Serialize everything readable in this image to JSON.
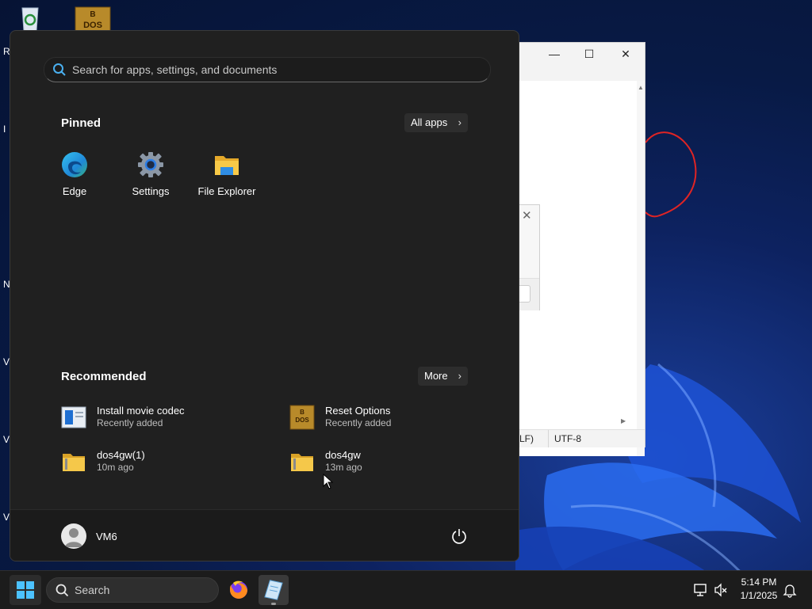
{
  "colors": {
    "accent": "#0078d4",
    "start_bg": "#202020",
    "taskbar_bg": "#1c1c1c"
  },
  "desktop": {
    "icons": [
      "recycle-bin-icon",
      "dosbox-icon"
    ],
    "edge_letters": [
      "R",
      "I",
      "N",
      "V",
      "V",
      "V"
    ]
  },
  "notepad": {
    "controls": [
      "—",
      "☐",
      "✕"
    ],
    "status": {
      "line_ending": "LF)",
      "encoding": "UTF-8"
    }
  },
  "start_menu": {
    "search": {
      "placeholder": "Search for apps, settings, and documents"
    },
    "pinned": {
      "title": "Pinned",
      "all_apps_label": "All apps",
      "apps": [
        {
          "label": "Edge",
          "icon": "edge-icon"
        },
        {
          "label": "Settings",
          "icon": "settings-gear-icon"
        },
        {
          "label": "File Explorer",
          "icon": "file-explorer-icon"
        }
      ]
    },
    "recommended": {
      "title": "Recommended",
      "more_label": "More",
      "items": [
        {
          "name": "Install movie codec",
          "sub": "Recently added",
          "icon": "installer-icon"
        },
        {
          "name": "Reset Options",
          "sub": "Recently added",
          "icon": "dosbox-icon"
        },
        {
          "name": "dos4gw(1)",
          "sub": "10m ago",
          "icon": "zip-folder-icon"
        },
        {
          "name": "dos4gw",
          "sub": "13m ago",
          "icon": "zip-folder-icon"
        }
      ]
    },
    "user": {
      "name": "VM6"
    }
  },
  "taskbar": {
    "search_label": "Search",
    "apps": [
      "firefox-icon",
      "notepad-icon"
    ],
    "clock": {
      "time": "5:14 PM",
      "date": "1/1/2025"
    }
  }
}
